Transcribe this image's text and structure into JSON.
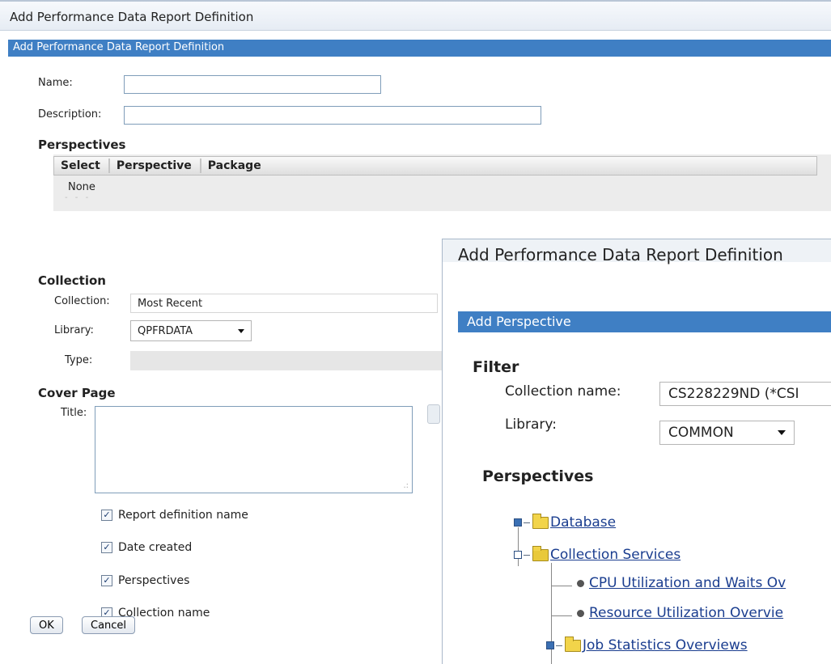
{
  "window": {
    "title": "Add Performance Data Report Definition"
  },
  "panel": {
    "title": "Add Performance Data Report Definition"
  },
  "form": {
    "name_label": "Name:",
    "name_value": "",
    "description_label": "Description:",
    "description_value": ""
  },
  "perspectives": {
    "heading": "Perspectives",
    "columns": [
      "Select",
      "Perspective",
      "Package"
    ],
    "empty_text": "None"
  },
  "collection": {
    "heading": "Collection",
    "collection_label": "Collection:",
    "collection_value": "Most Recent",
    "library_label": "Library:",
    "library_value": "QPFRDATA",
    "type_label": "Type:",
    "type_value": ""
  },
  "cover_page": {
    "heading": "Cover Page",
    "title_label": "Title:",
    "title_value": "",
    "options": [
      {
        "label": "Report definition name",
        "checked": true
      },
      {
        "label": "Date created",
        "checked": true
      },
      {
        "label": "Perspectives",
        "checked": true
      },
      {
        "label": "Collection name",
        "checked": true
      }
    ]
  },
  "buttons": {
    "ok": "OK",
    "cancel": "Cancel"
  },
  "overlay": {
    "title": "Add Performance Data Report Definition",
    "bar_title": "Add Perspective",
    "filter_heading": "Filter",
    "collection_name_label": "Collection name:",
    "collection_name_value": "CS228229ND (*CSI",
    "library_label": "Library:",
    "library_value": "COMMON",
    "perspectives_heading": "Perspectives",
    "tree": [
      {
        "label": "Database",
        "expanded": false,
        "type": "folder"
      },
      {
        "label": "Collection Services",
        "expanded": true,
        "type": "folder"
      },
      {
        "label": "CPU Utilization and Waits Ov",
        "type": "leaf"
      },
      {
        "label": "Resource Utilization Overvie",
        "type": "leaf"
      },
      {
        "label": "Job Statistics Overviews",
        "expanded": false,
        "type": "folder"
      }
    ]
  },
  "colors": {
    "accent_bar": "#3f7fc4",
    "link": "#1a3d8f"
  }
}
